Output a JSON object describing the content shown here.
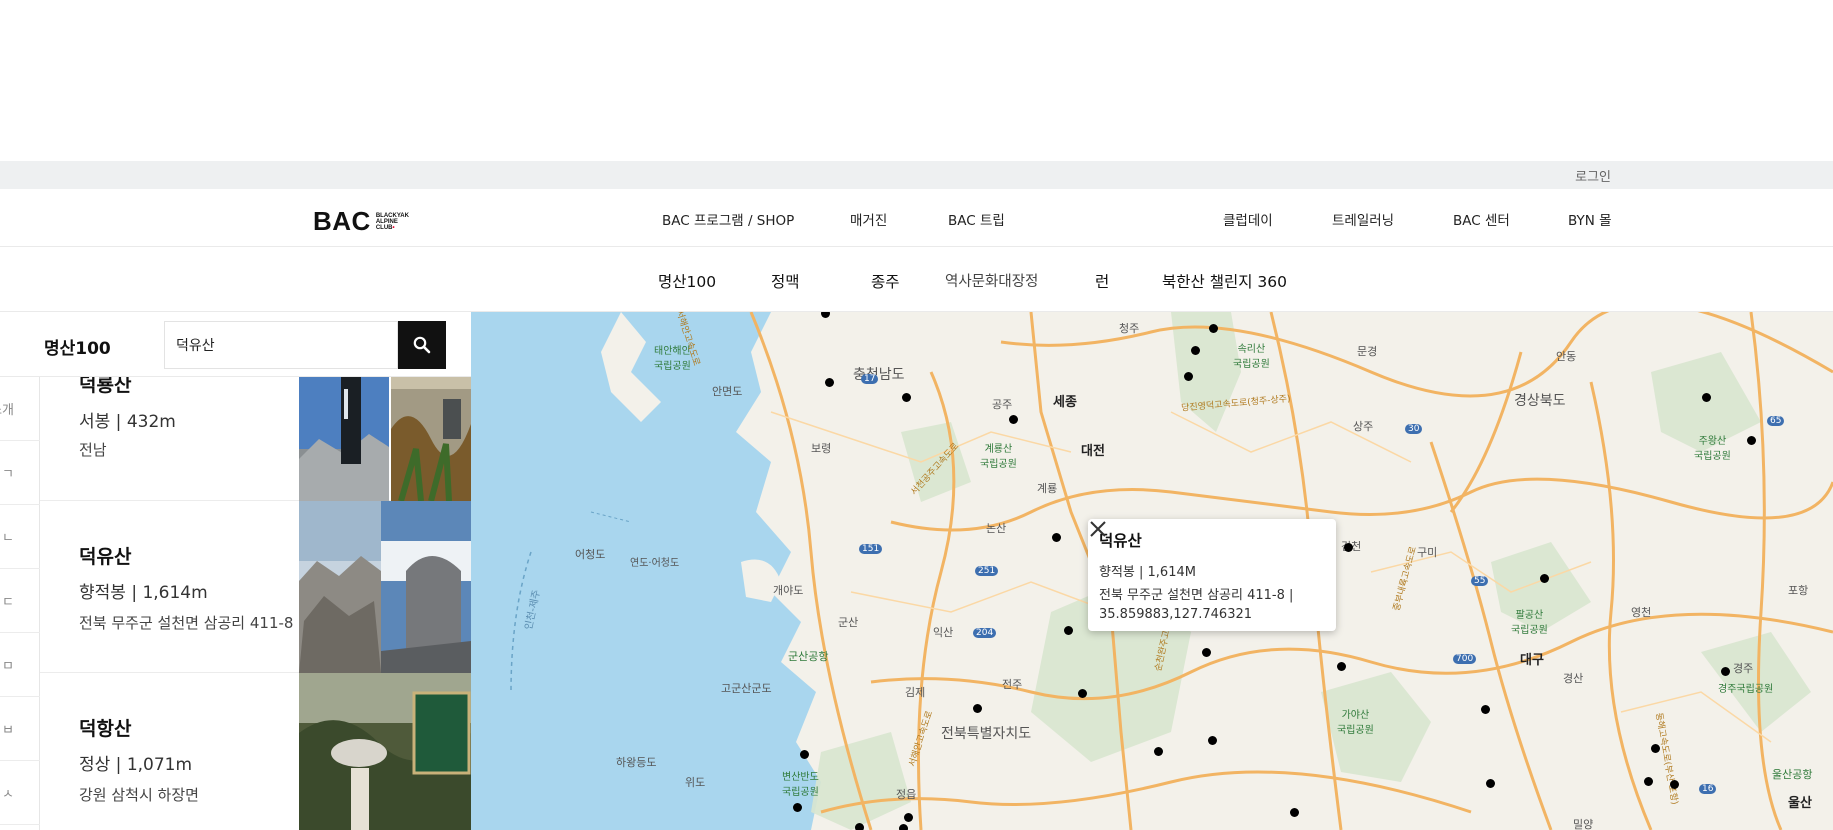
{
  "header": {
    "login_label": "로그인",
    "logo_text": "BAC",
    "logo_sub": [
      "BLACKYAK",
      "ALPINE",
      "CLUB"
    ],
    "nav": [
      "BAC 프로그램 / SHOP",
      "매거진",
      "BAC 트립",
      "클럽데이",
      "트레일러닝",
      "BAC 센터",
      "BYN 몰"
    ]
  },
  "subnav": [
    "명산100",
    "정맥",
    "종주",
    "역사문화대장정",
    "런",
    "북한산 챌린지 360"
  ],
  "panel": {
    "title": "명산100",
    "search_value": "덕유산",
    "index_items": [
      "소개",
      "ㄱ",
      "ㄴ",
      "ㄷ",
      "ㅁ",
      "ㅂ",
      "ㅅ"
    ],
    "mountains": [
      {
        "name": "덕룡산",
        "peak": "서봉 | 432m",
        "address": "전남"
      },
      {
        "name": "덕유산",
        "peak": "향적봉 | 1,614m",
        "address": "전북 무주군 설천면 삼공리 411-8"
      },
      {
        "name": "덕항산",
        "peak": "정상 | 1,071m",
        "address": "강원 삼척시 하장면"
      }
    ]
  },
  "map": {
    "labels": {
      "region_chungnam": "충청남도",
      "region_gyeongbuk": "경상북도",
      "region_jeonbuk": "전북특별자치도",
      "sejong": "세종",
      "daejeon": "대전",
      "daegu": "대구",
      "ulsan": "울산",
      "cheongju": "청주",
      "gongju": "공주",
      "boryeong": "보령",
      "nonsan": "논산",
      "gyeryong": "계룡",
      "gunsan": "군산",
      "iksan": "익산",
      "jeonju": "전주",
      "gimje": "김제",
      "jeongeup": "정읍",
      "andong": "안동",
      "mungyeong": "문경",
      "sangju": "상주",
      "gimcheon": "김천",
      "gumi": "구미",
      "yeongcheon": "영천",
      "gyeongsan": "경산",
      "gyeongju": "경주",
      "pohang": "포항",
      "miryang": "밀양",
      "andeok": "안면도",
      "eocheongdo": "어청도",
      "yeondo": "연도·어청도",
      "gaeyado": "개야도",
      "gogunsan": "고군산군도",
      "wido": "위도",
      "haryang": "하왕등도",
      "incheon_route": "인천-제주",
      "gunsan_airport": "군산공항",
      "taean_park": "태안해안\n국립공원",
      "gyeryong_park": "계룡산\n국립공원",
      "songni_park": "속리산\n국립공원",
      "juwang_park": "주왕산\n국립공원",
      "palgong_park": "팔공산\n국립공원",
      "gaya_park": "가야산\n국립공원",
      "gyeongju_park": "경주국립공원",
      "byeonsan_park": "변산반도\n국립공원",
      "ulsan_airport": "울산공항",
      "route_17": "17",
      "route_30": "30",
      "route_65": "65",
      "route_151": "151",
      "route_251": "251",
      "route_204": "204",
      "route_55": "55",
      "route_700": "700",
      "route_16": "16",
      "hw_seohaean": "서해안고속도로",
      "hw_dangjin": "당진영덕고속도로(청주-상주)",
      "hw_nonsan": "서천공주고속도로",
      "hw_suncheon": "순천완주고속도로",
      "hw_jungbu": "중부내륙고속도로",
      "hw_donghae": "동해고속도로(부산-포항)",
      "hw_honam": "서해안고속도로"
    },
    "popup": {
      "title": "덕유산",
      "peak": "향적봉 | 1,614M",
      "address": "전북 무주군 설천면 삼공리 411-8 |",
      "coords": "35.859883,127.746321"
    }
  },
  "colors": {
    "sea": "#a9d6ee",
    "land": "#f3f1ea",
    "green": "#d8e6cf",
    "road": "#f2b463",
    "search_button": "#111111"
  }
}
